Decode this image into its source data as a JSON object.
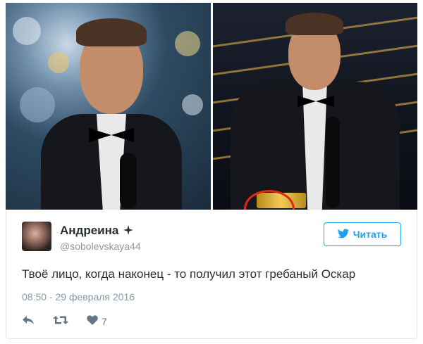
{
  "tweet": {
    "display_name": "Андреина",
    "username": "@sobolevskaya44",
    "follow_label": "Читать",
    "text": "Твоё лицо, когда наконец - то получил этот гребаный Оскар",
    "timestamp": "08:50 - 29 февраля 2016",
    "like_count": "7"
  },
  "icons": {
    "name_badge": "cross-star-icon",
    "follow": "twitter-bird-icon",
    "reply": "reply-icon",
    "retweet": "retweet-icon",
    "like": "heart-icon"
  },
  "colors": {
    "accent": "#1da1f2",
    "text_primary": "#292f33",
    "text_secondary": "#8899a6",
    "highlight_circle": "#e0241a"
  }
}
